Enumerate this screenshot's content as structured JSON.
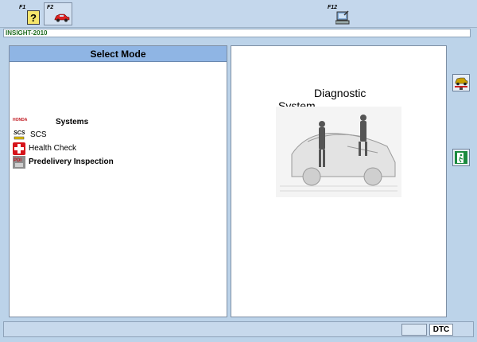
{
  "toolbar": {
    "keys": [
      {
        "label": "F1",
        "icon": "help-icon"
      },
      {
        "label": "F2",
        "icon": "car-icon"
      },
      {
        "label": "F12",
        "icon": "computer-tools-icon"
      }
    ]
  },
  "vehicle": {
    "model": "INSIGHT-2010"
  },
  "left_panel": {
    "header": "Select Mode",
    "items": [
      {
        "label": "Systems",
        "icon": "honda-logo-icon",
        "logo_text": "HONDA"
      },
      {
        "label": "SCS",
        "icon": "scs-connector-icon",
        "logo_text": "SCS"
      },
      {
        "label": "Health Check",
        "icon": "health-cross-icon"
      },
      {
        "label": "Predelivery Inspection",
        "icon": "pdi-icon",
        "logo_text": "PDI"
      }
    ]
  },
  "right_panel": {
    "title_line1": "Diagnostic",
    "title_line2": "System",
    "image": "vehicle-technicians-illustration"
  },
  "side_buttons": [
    {
      "icon": "vehicle-lift-icon"
    },
    {
      "icon": "exit-door-icon"
    }
  ],
  "status": {
    "dtc_label": "DTC"
  },
  "colors": {
    "background": "#bcd3e9",
    "header": "#8fb5e4",
    "vehicle_text": "#1e6b1e"
  }
}
